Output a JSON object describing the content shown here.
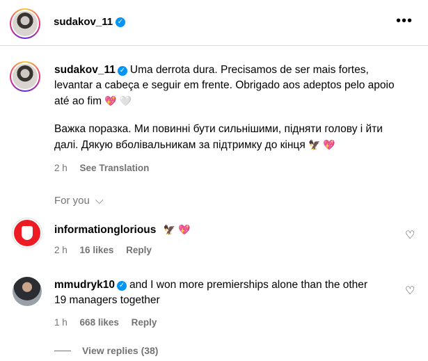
{
  "header": {
    "username": "sudakov_11",
    "verified_icon": "verified-check-icon",
    "more_icon": "•••"
  },
  "caption": {
    "username": "sudakov_11",
    "text_pt": "Uma derrota dura. Precisamos de ser mais fortes, levantar a cabeça e seguir em frente. Obrigado aos adeptos pelo apoio até ao fim",
    "emoji_pt": "💖 🤍",
    "text_uk": "Важка поразка. Ми повинні бути сильнішими, підняти голову і йти далі. Дякую вболівальникам за підтримку до кінця",
    "emoji_uk": "🦅 💖",
    "time": "2 h",
    "see_translation": "See Translation"
  },
  "for_you": {
    "label": "For you",
    "chevron": "⌵"
  },
  "comments": [
    {
      "username": "informationglorious",
      "text": "",
      "emoji": "🦅 💖",
      "time": "2 h",
      "likes": "16 likes",
      "reply": "Reply",
      "heart": "♡"
    },
    {
      "username": "mmudryk10",
      "text": "and I won more premierships alone than the other 19 managers together",
      "time": "1 h",
      "likes": "668 likes",
      "reply": "Reply",
      "heart": "♡"
    }
  ],
  "view_replies": "View replies (38)"
}
